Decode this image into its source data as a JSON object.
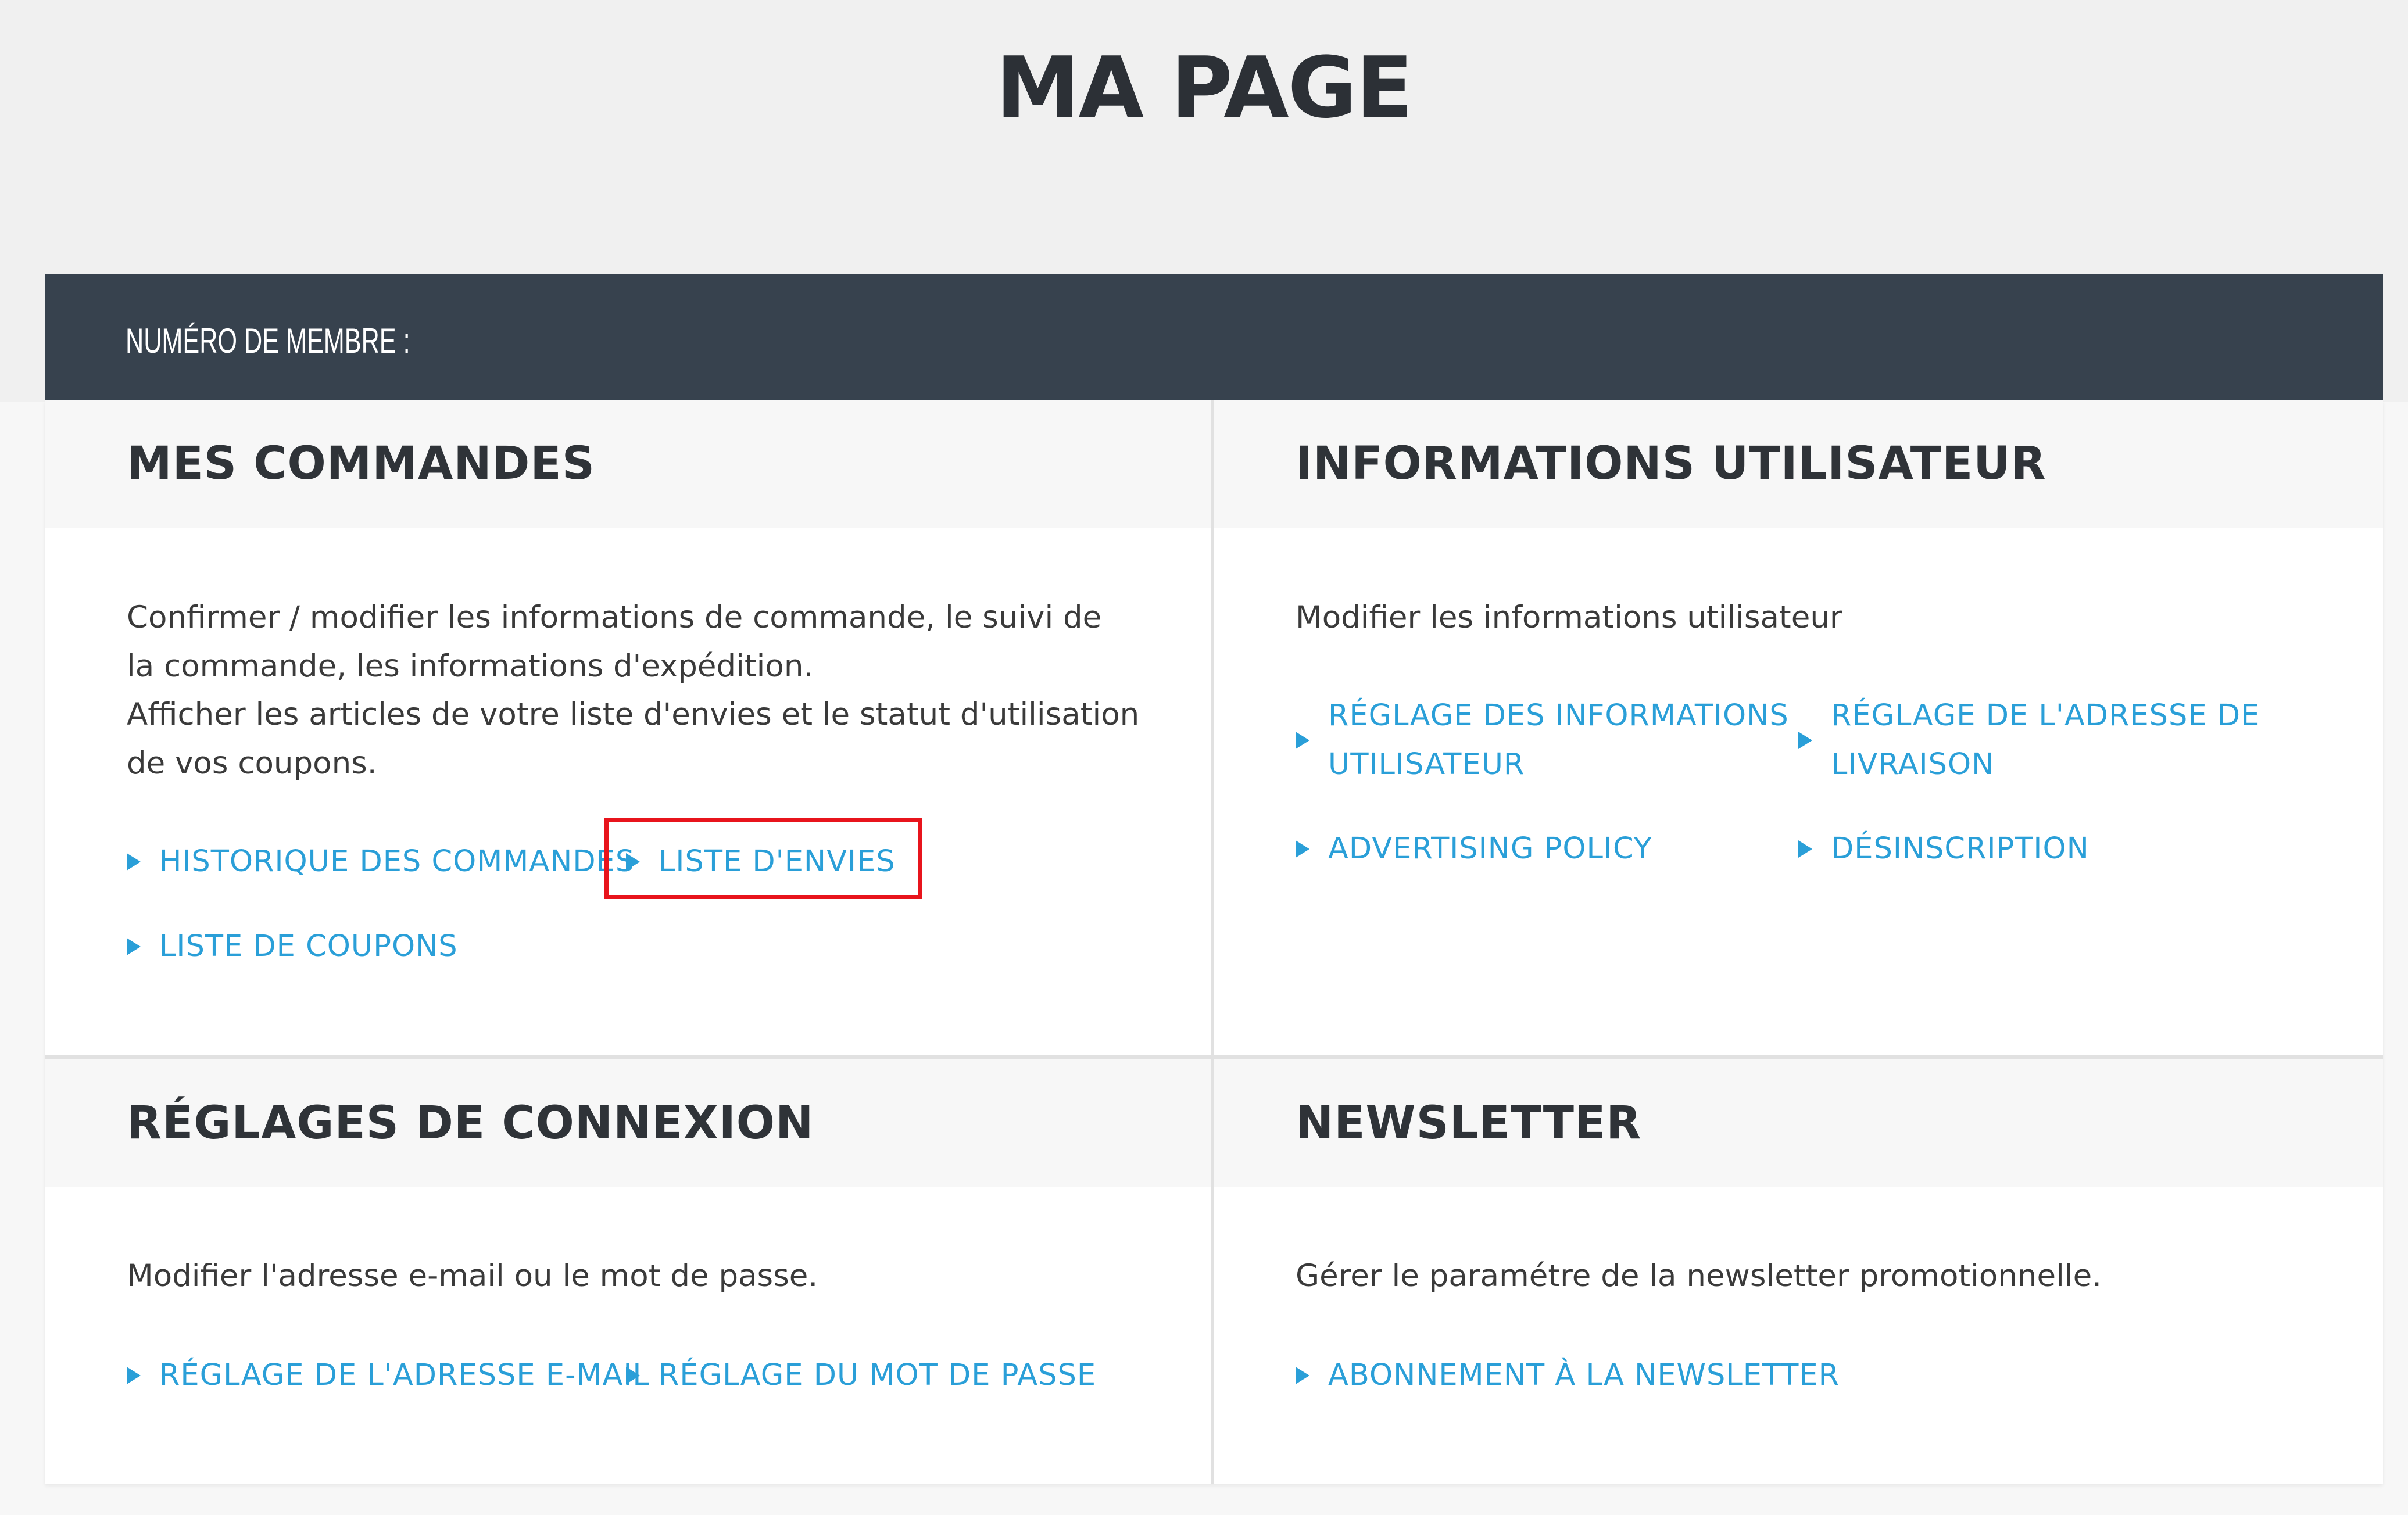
{
  "page": {
    "title": "MA PAGE"
  },
  "member_bar": {
    "label": "NUMÉRO DE MEMBRE :"
  },
  "cards": {
    "orders": {
      "title": "MES COMMANDES",
      "desc_lines": [
        "Confirmer / modifier les informations de commande, le suivi de",
        "la commande, les informations d'expédition.",
        "Afficher les articles de votre liste d'envies et le statut d'utilisation",
        "de vos coupons."
      ],
      "links": [
        "HISTORIQUE DES COMMANDES",
        "LISTE D'ENVIES",
        "LISTE DE COUPONS"
      ]
    },
    "user_info": {
      "title": "INFORMATIONS UTILISATEUR",
      "desc": "Modifier les informations utilisateur",
      "links": [
        {
          "line1": "RÉGLAGE DES INFORMATIONS",
          "line2": "UTILISATEUR"
        },
        {
          "line1": "RÉGLAGE DE L'ADRESSE DE",
          "line2": "LIVRAISON"
        },
        "ADVERTISING POLICY",
        "DÉSINSCRIPTION"
      ]
    },
    "login": {
      "title": "RÉGLAGES DE CONNEXION",
      "desc": "Modifier l'adresse e-mail ou le mot de passe.",
      "links": [
        "RÉGLAGE DE L'ADRESSE E-MAIL",
        "RÉGLAGE DU MOT DE PASSE"
      ]
    },
    "newsletter": {
      "title": "NEWSLETTER",
      "desc": "Gérer le paramétre de la newsletter promotionnelle.",
      "links": [
        "ABONNEMENT À LA NEWSLETTER"
      ]
    }
  },
  "colors": {
    "link": "#2a9fd8",
    "member_bar": "#37424e",
    "highlight": "#e8141c",
    "title_text": "#2c3036"
  },
  "icons": {
    "link_bullet": "triangle-right-icon"
  }
}
